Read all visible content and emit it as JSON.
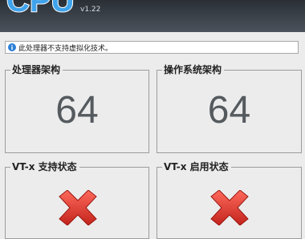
{
  "app": {
    "logo_text": "CPU",
    "version": "v1.22"
  },
  "info": {
    "icon": "info-icon",
    "message": "此处理器不支持虚拟化技术。"
  },
  "panels": {
    "cpu_arch": {
      "title": "处理器架构",
      "value": "64"
    },
    "os_arch": {
      "title": "操作系统架构",
      "value": "64"
    },
    "vtx_support": {
      "title": "VT-x 支持状态",
      "status_icon": "red-x-icon"
    },
    "vtx_enabled": {
      "title": "VT-x 启用状态",
      "status_icon": "red-x-icon"
    }
  },
  "colors": {
    "header_bg": "#3a4047",
    "logo": "#3fa3ec",
    "status_no": "#d9302a",
    "value_text": "#555a5e"
  }
}
